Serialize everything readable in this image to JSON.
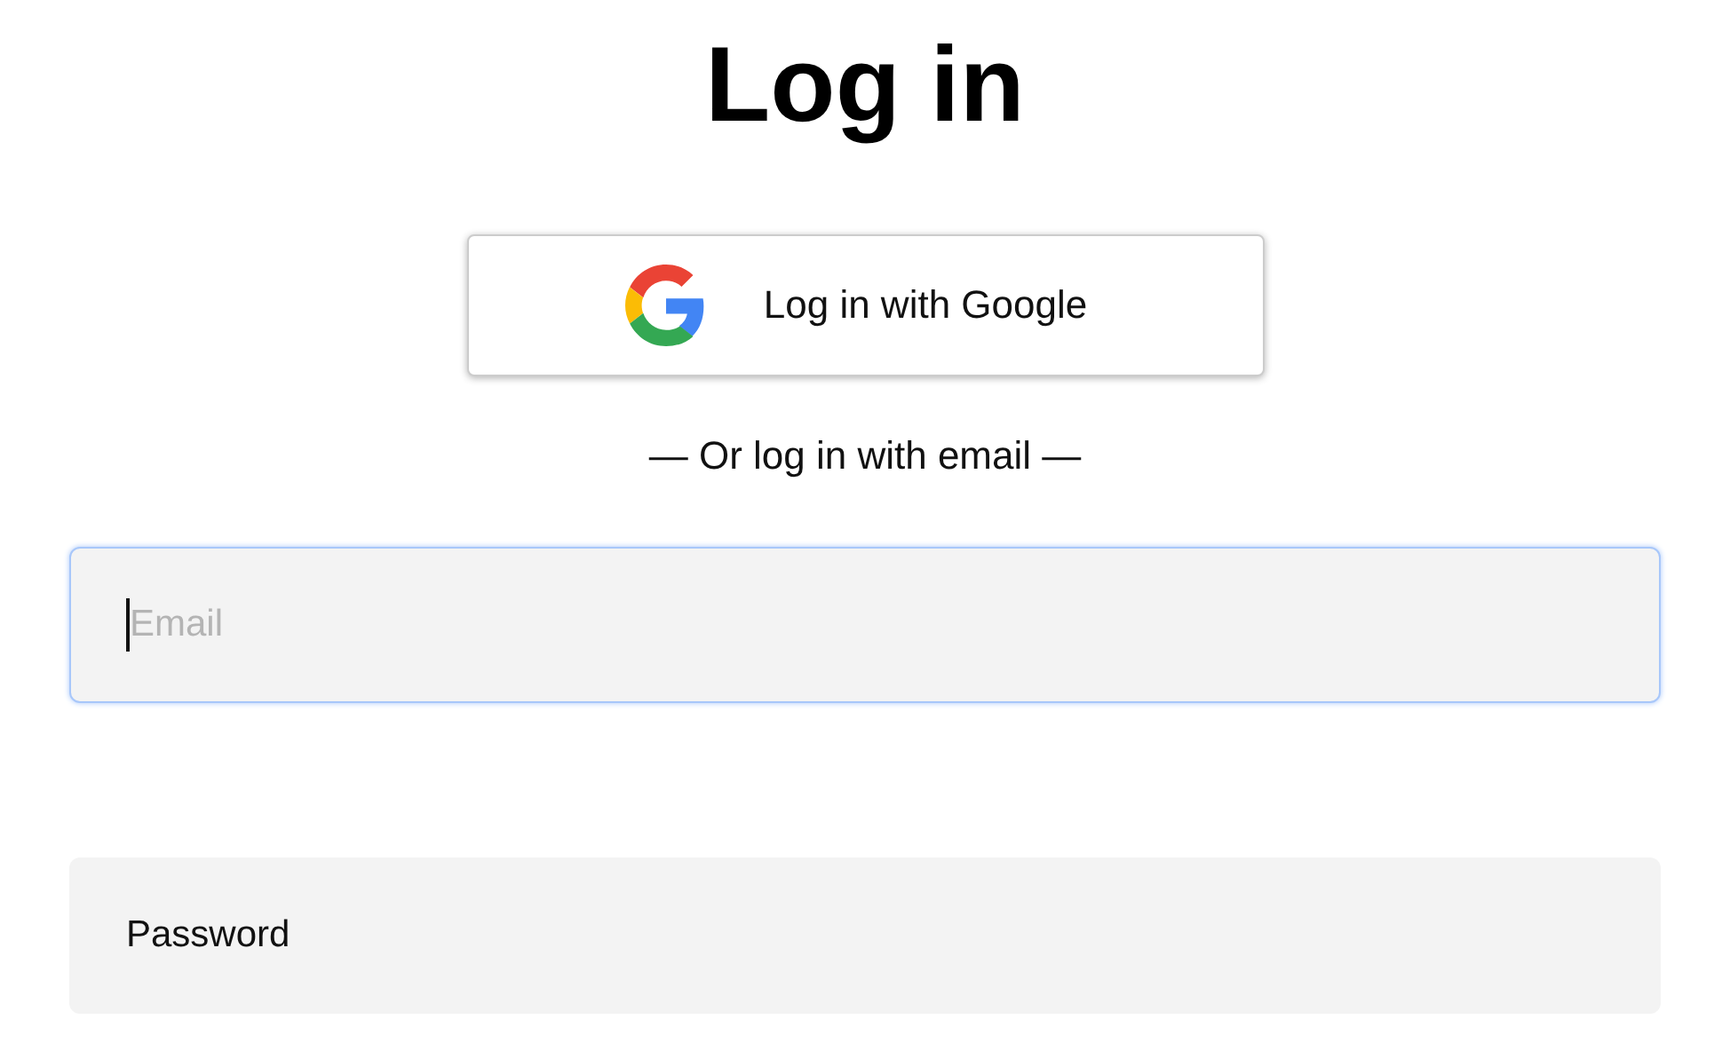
{
  "title": "Log in",
  "google_button": {
    "label": "Log in with Google"
  },
  "divider": "— Or log in with email —",
  "email_field": {
    "placeholder": "Email",
    "focused": true
  },
  "password_field": {
    "label": "Password",
    "focused": false
  }
}
